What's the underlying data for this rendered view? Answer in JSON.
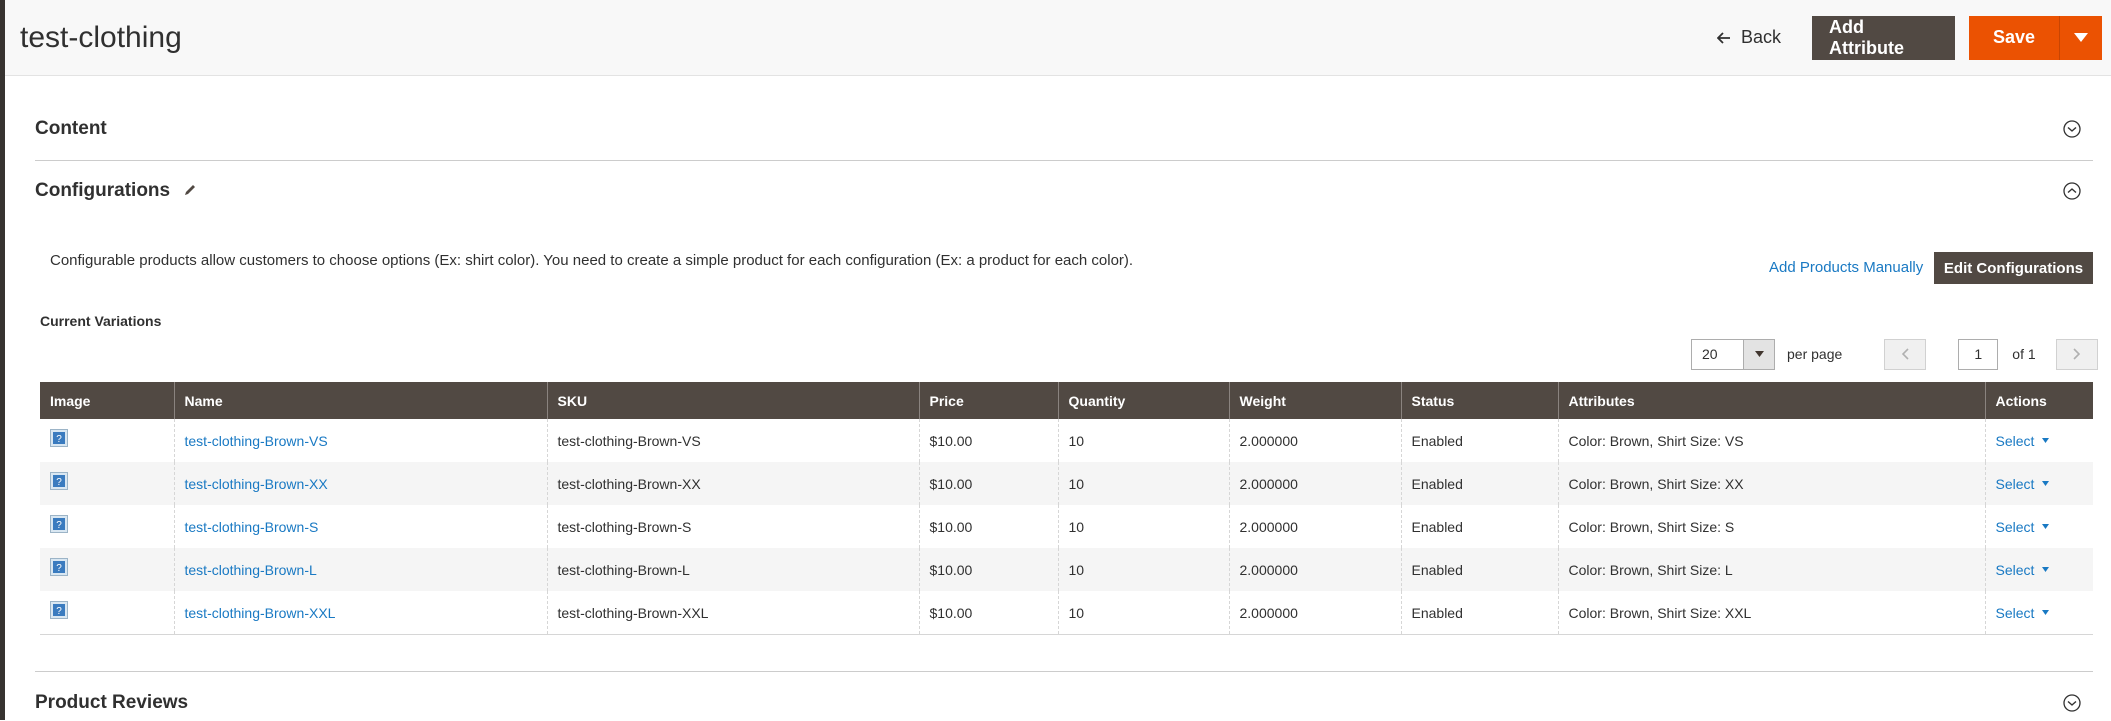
{
  "header": {
    "title": "test-clothing",
    "back_label": "Back",
    "add_attribute_label": "Add Attribute",
    "save_label": "Save"
  },
  "sections": {
    "content_title": "Content",
    "configurations_title": "Configurations",
    "reviews_title": "Product Reviews"
  },
  "configurations": {
    "description": "Configurable products allow customers to choose options (Ex: shirt color). You need to create a simple product for each configuration (Ex: a product for each color).",
    "add_manually_label": "Add Products Manually",
    "edit_configurations_label": "Edit Configurations",
    "current_variations_label": "Current Variations"
  },
  "pager": {
    "per_page_value": "20",
    "per_page_label": "per page",
    "current_page": "1",
    "of_label": "of 1"
  },
  "grid": {
    "columns": [
      "Image",
      "Name",
      "SKU",
      "Price",
      "Quantity",
      "Weight",
      "Status",
      "Attributes",
      "Actions"
    ],
    "rows": [
      {
        "name": "test-clothing-Brown-VS",
        "sku": "test-clothing-Brown-VS",
        "price": "$10.00",
        "quantity": "10",
        "weight": "2.000000",
        "status": "Enabled",
        "attributes": "Color: Brown, Shirt Size: VS",
        "action": "Select"
      },
      {
        "name": "test-clothing-Brown-XX",
        "sku": "test-clothing-Brown-XX",
        "price": "$10.00",
        "quantity": "10",
        "weight": "2.000000",
        "status": "Enabled",
        "attributes": "Color: Brown, Shirt Size: XX",
        "action": "Select"
      },
      {
        "name": "test-clothing-Brown-S",
        "sku": "test-clothing-Brown-S",
        "price": "$10.00",
        "quantity": "10",
        "weight": "2.000000",
        "status": "Enabled",
        "attributes": "Color: Brown, Shirt Size: S",
        "action": "Select"
      },
      {
        "name": "test-clothing-Brown-L",
        "sku": "test-clothing-Brown-L",
        "price": "$10.00",
        "quantity": "10",
        "weight": "2.000000",
        "status": "Enabled",
        "attributes": "Color: Brown, Shirt Size: L",
        "action": "Select"
      },
      {
        "name": "test-clothing-Brown-XXL",
        "sku": "test-clothing-Brown-XXL",
        "price": "$10.00",
        "quantity": "10",
        "weight": "2.000000",
        "status": "Enabled",
        "attributes": "Color: Brown, Shirt Size: XXL",
        "action": "Select"
      }
    ]
  },
  "icons": {
    "back": "arrow-left-icon",
    "save_toggle": "caret-down-icon",
    "collapse": "chevron-circle-icon",
    "edit": "pencil-icon",
    "thumbnail": "placeholder-image-icon"
  },
  "colors": {
    "accent": "#eb5202",
    "dark_button": "#514943",
    "link": "#1979c3"
  }
}
